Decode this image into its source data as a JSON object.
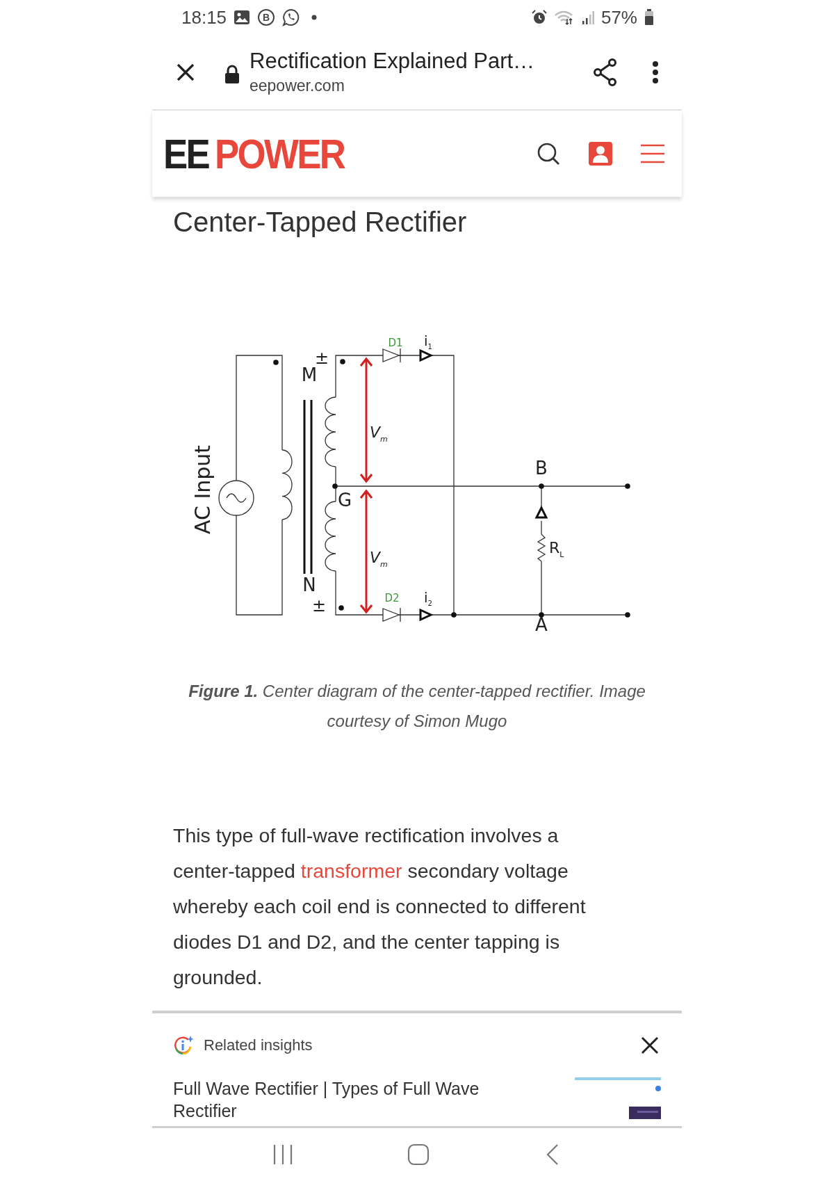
{
  "status_bar": {
    "time": "18:15",
    "app_badge": "B",
    "battery": "57%"
  },
  "browser_bar": {
    "title": "Rectification Explained Part…",
    "url": "eepower.com"
  },
  "site_header": {
    "logo_mark": "EE",
    "logo_name": "POWER"
  },
  "article": {
    "heading": "Center-Tapped Rectifier",
    "figure": {
      "input": "AC Input",
      "nodes": [
        "M",
        "N",
        "G",
        "B",
        "A"
      ],
      "diodes": [
        "D1",
        "D2"
      ],
      "currents": [
        {
          "text": "i",
          "sub": "1"
        },
        {
          "text": "i",
          "sub": "2"
        }
      ],
      "voltages": [
        {
          "text": "V",
          "sub": "m"
        },
        {
          "text": "V",
          "sub": "m"
        }
      ],
      "load": {
        "text": "R",
        "sub": "L"
      },
      "polarity": [
        "±",
        "±"
      ]
    },
    "caption": "**Figure 1.** Center diagram of the center-tapped rectifier. Image courtesy of Simon Mugo",
    "paragraph": [
      {
        "kind": "text",
        "text": "This type of full-wave rectification involves a center-tapped "
      },
      {
        "kind": "link",
        "text": "transformer"
      },
      {
        "kind": "text",
        "text": " secondary voltage whereby each coil end is connected to different diodes D1 and D2, and the center tapping is grounded."
      }
    ]
  },
  "related_insights": {
    "title": "Related insights",
    "items": [
      {
        "title": "Full Wave Rectifier | Types of Full Wave Rectifier"
      }
    ]
  }
}
